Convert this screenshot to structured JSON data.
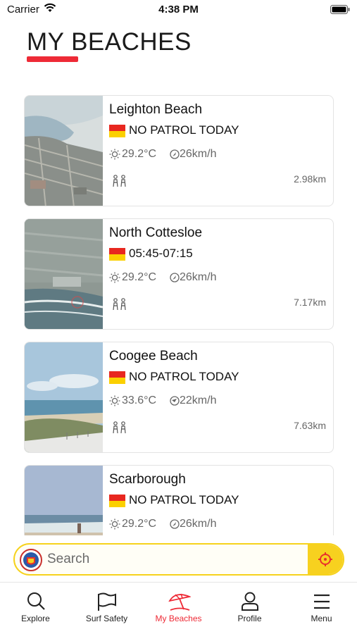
{
  "status_bar": {
    "carrier": "Carrier",
    "time": "4:38 PM"
  },
  "page": {
    "title": "MY BEACHES",
    "accent": "#ee2a36"
  },
  "beaches": [
    {
      "name": "Leighton Beach",
      "patrol": "NO PATROL TODAY",
      "temp": "29.2°C",
      "wind": "26km/h",
      "distance": "2.98km",
      "photo": "aerial-coast"
    },
    {
      "name": "North Cottesloe",
      "patrol": "05:45-07:15",
      "temp": "29.2°C",
      "wind": "26km/h",
      "distance": "7.17km",
      "photo": "aerial-suburb"
    },
    {
      "name": "Coogee Beach",
      "patrol": "NO PATROL TODAY",
      "temp": "33.6°C",
      "wind": "22km/h",
      "distance": "7.63km",
      "photo": "dunes-sea"
    },
    {
      "name": "Scarborough",
      "patrol": "NO PATROL TODAY",
      "temp": "29.2°C",
      "wind": "26km/h",
      "distance": "",
      "photo": "beach-shore"
    }
  ],
  "search": {
    "placeholder": "Search",
    "value": ""
  },
  "tabs": [
    {
      "label": "Explore",
      "icon": "search-icon"
    },
    {
      "label": "Surf Safety",
      "icon": "flag-icon"
    },
    {
      "label": "My Beaches",
      "icon": "umbrella-icon",
      "active": true
    },
    {
      "label": "Profile",
      "icon": "person-icon"
    },
    {
      "label": "Menu",
      "icon": "menu-icon"
    }
  ],
  "colors": {
    "brand_yellow": "#f7d11f",
    "flag_red": "#e8271f",
    "flag_yellow": "#fbd000"
  }
}
